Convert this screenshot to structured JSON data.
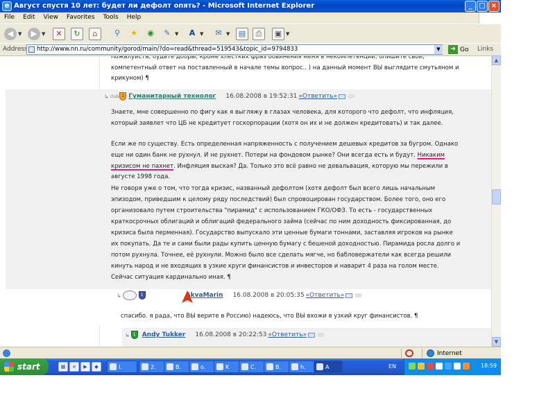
{
  "window": {
    "title": "Август спустя 10 лет: будет ли дефолт опять? - Microsoft Internet Explorer"
  },
  "menu": [
    "File",
    "Edit",
    "View",
    "Favorites",
    "Tools",
    "Help"
  ],
  "address": {
    "label": "Address",
    "url": "http://www.nn.ru/community/gorod/main/?do=read&thread=519543&topic_id=9794833",
    "go_label": "Go",
    "links_label": "Links"
  },
  "content": {
    "top_lines": [
      "пожалуйста, будьте добры, кроме хлестких фраз обвинения меня в некомпетенции, опишите свой,",
      "компетентный ответ на поставленный в начале темы вопрос.. ) на данный момент ВЫ выглядите смутьяном и",
      "крикуном) ¶"
    ],
    "post1": {
      "club": "club",
      "author": "Гуманитарный технолог",
      "date": "16.08.2008 в 19:52:31",
      "reply": "«Ответить»",
      "lines": [
        "Знаете, мне совершенно по фигу как я выгляжу в глазах человека, для которого что дефолт, что инфляция,",
        "который заявлет что ЦБ не кредитует госкорпорации (хотя он их и не должен кредитовать) и так далее.",
        "",
        "Если же по существу. Есть определенная напряженность с получением дешевых кредитов за бугром. Однако",
        "еще ни один банк не рухнул. И не рухнет. Потери на фондовом рынке? Они всегда есть и будут.",
        "кризисом не пахнет",
        ". Инфляция выская? Да. Только это всё равно не девальвация, которую мы пережили в",
        "августе 1998 года.",
        "Не говоря уже о том, что тогда кризис, названный дефолтом (хотя дефолт был всего лишь начальным",
        "эпизодом, приведшим к целому ряду последствий) был спровоцирован государством. Более того, оно его",
        "организовало путем строительства \"пирамид\" с использованием ГКО/ОФЗ. То есть - государственных",
        "краткосрочных облигаций и облигаций федерального займа (сейчас по ним доходность фиксированная, до",
        "кризиса была перменная). Государство выпускало эти ценные бумаги тоннами, заставляя игроков на рынке",
        "их покупать. Да те и сами были рады купить ценную бумагу с бешеной доходностью. Пирамида росла долго и",
        "потом рухнула. Точнее, её рухнули. Можно было все сделать мягче, но бабловержатели как всегда решили",
        "кинуть народ и не входящих в узкие круги финансистов и инвесторов и наварит 4 раза на голом месте.",
        "Сейчас ситуация кардинально иная. ¶"
      ],
      "highlight": "Никаким"
    },
    "post2": {
      "author": "AkvaMarin",
      "date": "16.08.2008 в 20:05:35",
      "reply": "«Ответить»",
      "text": "спасибо. я рада, что ВЫ верите в Россию) надеюсь, что ВЫ вхожи в узкий круг финансистов. ¶"
    },
    "post3": {
      "author": "Andy Tukker",
      "date": "16.08.2008 в 20:22:53",
      "reply": "«Ответить»"
    }
  },
  "status": {
    "zone": "Internet"
  },
  "taskbar": {
    "start": "start",
    "tasks": [
      "I.",
      "2.",
      "B.",
      "o.",
      "K",
      "C.",
      "B.",
      "h.",
      "A"
    ],
    "lang": "EN",
    "clock": "18:59"
  },
  "colors": {
    "titlebar": "#0a5fd8",
    "author_link": "#2d7a6b",
    "reply_link": "#2b5aa8",
    "underline_highlight": "#d61a8a"
  },
  "icons": [
    "back-icon",
    "forward-icon",
    "stop-icon",
    "refresh-icon",
    "home-icon",
    "search-icon",
    "favorites-icon",
    "history-icon",
    "media-icon",
    "font-icon",
    "mail-icon",
    "edit-icon",
    "print-icon",
    "messenger-icon",
    "envelope-icon",
    "trash-icon",
    "globe-icon"
  ]
}
